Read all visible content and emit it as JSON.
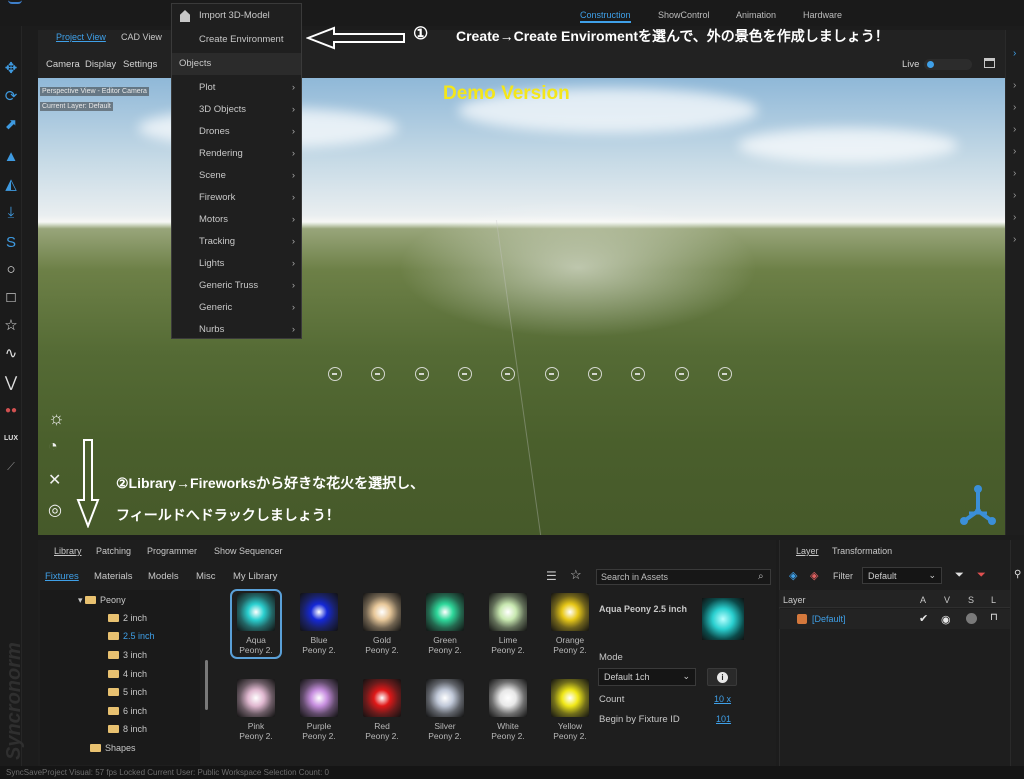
{
  "top_tabs": [
    "Construction",
    "ShowControl",
    "Animation",
    "Hardware"
  ],
  "view_tabs": [
    "Project View",
    "CAD View"
  ],
  "view_submenu": [
    "Camera",
    "Display",
    "Settings"
  ],
  "live": {
    "label": "Live"
  },
  "viewport": {
    "label1": "Perspective View - Editor Camera",
    "label2": "Current Layer: Default",
    "demo": "Demo Version"
  },
  "create_menu": {
    "items": [
      {
        "label": "Import 3D-Model",
        "arrow": false
      },
      {
        "label": "Create Environment",
        "arrow": false
      },
      {
        "label": "Objects",
        "arrow": false,
        "header": true
      },
      {
        "label": "Plot",
        "arrow": true
      },
      {
        "label": "3D Objects",
        "arrow": true
      },
      {
        "label": "Drones",
        "arrow": true
      },
      {
        "label": "Rendering",
        "arrow": true
      },
      {
        "label": "Scene",
        "arrow": true
      },
      {
        "label": "Firework",
        "arrow": true
      },
      {
        "label": "Motors",
        "arrow": true
      },
      {
        "label": "Tracking",
        "arrow": true
      },
      {
        "label": "Lights",
        "arrow": true
      },
      {
        "label": "Generic Truss",
        "arrow": true
      },
      {
        "label": "Generic",
        "arrow": true
      },
      {
        "label": "Nurbs",
        "arrow": true
      }
    ]
  },
  "annotations": {
    "step1_num": "①",
    "step1_text": "Create→Create Enviromentを選んで、外の景色を作成しましょう！",
    "step2_line1": "②Library→Fireworksから好きな花火を選択し、",
    "step2_line2": "フィールドへドラックしましょう！"
  },
  "library": {
    "tabs": [
      "Library",
      "Patching",
      "Programmer",
      "Show Sequencer"
    ],
    "subtabs": [
      "Fixtures",
      "Materials",
      "Models",
      "Misc",
      "My Library"
    ],
    "tree": [
      {
        "label": "Peony",
        "level": 0,
        "expand": "▾"
      },
      {
        "label": "2 inch",
        "level": 1
      },
      {
        "label": "2.5 inch",
        "level": 1,
        "selected": true
      },
      {
        "label": "3 inch",
        "level": 1
      },
      {
        "label": "4 inch",
        "level": 1
      },
      {
        "label": "5 inch",
        "level": 1
      },
      {
        "label": "6 inch",
        "level": 1
      },
      {
        "label": "8 inch",
        "level": 1
      },
      {
        "label": "Shapes",
        "level": 0
      }
    ],
    "search_placeholder": "Search in Assets",
    "items": [
      {
        "line1": "Aqua",
        "line2": "Peony 2.",
        "color": "#2ad0d0",
        "selected": true
      },
      {
        "line1": "Blue",
        "line2": "Peony 2.",
        "color": "#1428d8"
      },
      {
        "line1": "Gold",
        "line2": "Peony 2.",
        "color": "#e8c89a"
      },
      {
        "line1": "Green",
        "line2": "Peony 2.",
        "color": "#2ed89a"
      },
      {
        "line1": "Lime",
        "line2": "Peony 2.",
        "color": "#c8e8b0"
      },
      {
        "line1": "Orange",
        "line2": "Peony 2.",
        "color": "#e8c818"
      },
      {
        "line1": "Pink",
        "line2": "Peony 2.",
        "color": "#e0b8d0"
      },
      {
        "line1": "Purple",
        "line2": "Peony 2.",
        "color": "#c890e0"
      },
      {
        "line1": "Red",
        "line2": "Peony 2.",
        "color": "#e01818"
      },
      {
        "line1": "Silver",
        "line2": "Peony 2.",
        "color": "#c0c8d8"
      },
      {
        "line1": "White",
        "line2": "Peony 2.",
        "color": "#e8e8e8"
      },
      {
        "line1": "Yellow",
        "line2": "Peony 2.",
        "color": "#f0e818"
      }
    ],
    "details": {
      "title": "Aqua Peony 2.5 inch",
      "mode_label": "Mode",
      "mode_value": "Default 1ch",
      "count_label": "Count",
      "count_value": "10 x",
      "begin_label": "Begin by Fixture ID",
      "begin_value": "101"
    }
  },
  "layer_panel": {
    "tabs": [
      "Layer",
      "Transformation"
    ],
    "filter_label": "Filter",
    "filter_value": "Default",
    "col_layer": "Layer",
    "cols": [
      "A",
      "V",
      "S",
      "L"
    ],
    "row_label": "[Default]"
  },
  "status_bar": "SyncSaveProject   Visual: 57 fps Locked   Current User:   Public Workspace   Selection Count:   0",
  "brand_watermark": "Syncronorm",
  "colors": {
    "accent": "#3fa0e8",
    "demo_text": "#f4e61a",
    "layer_swatch": "#d4783c"
  }
}
